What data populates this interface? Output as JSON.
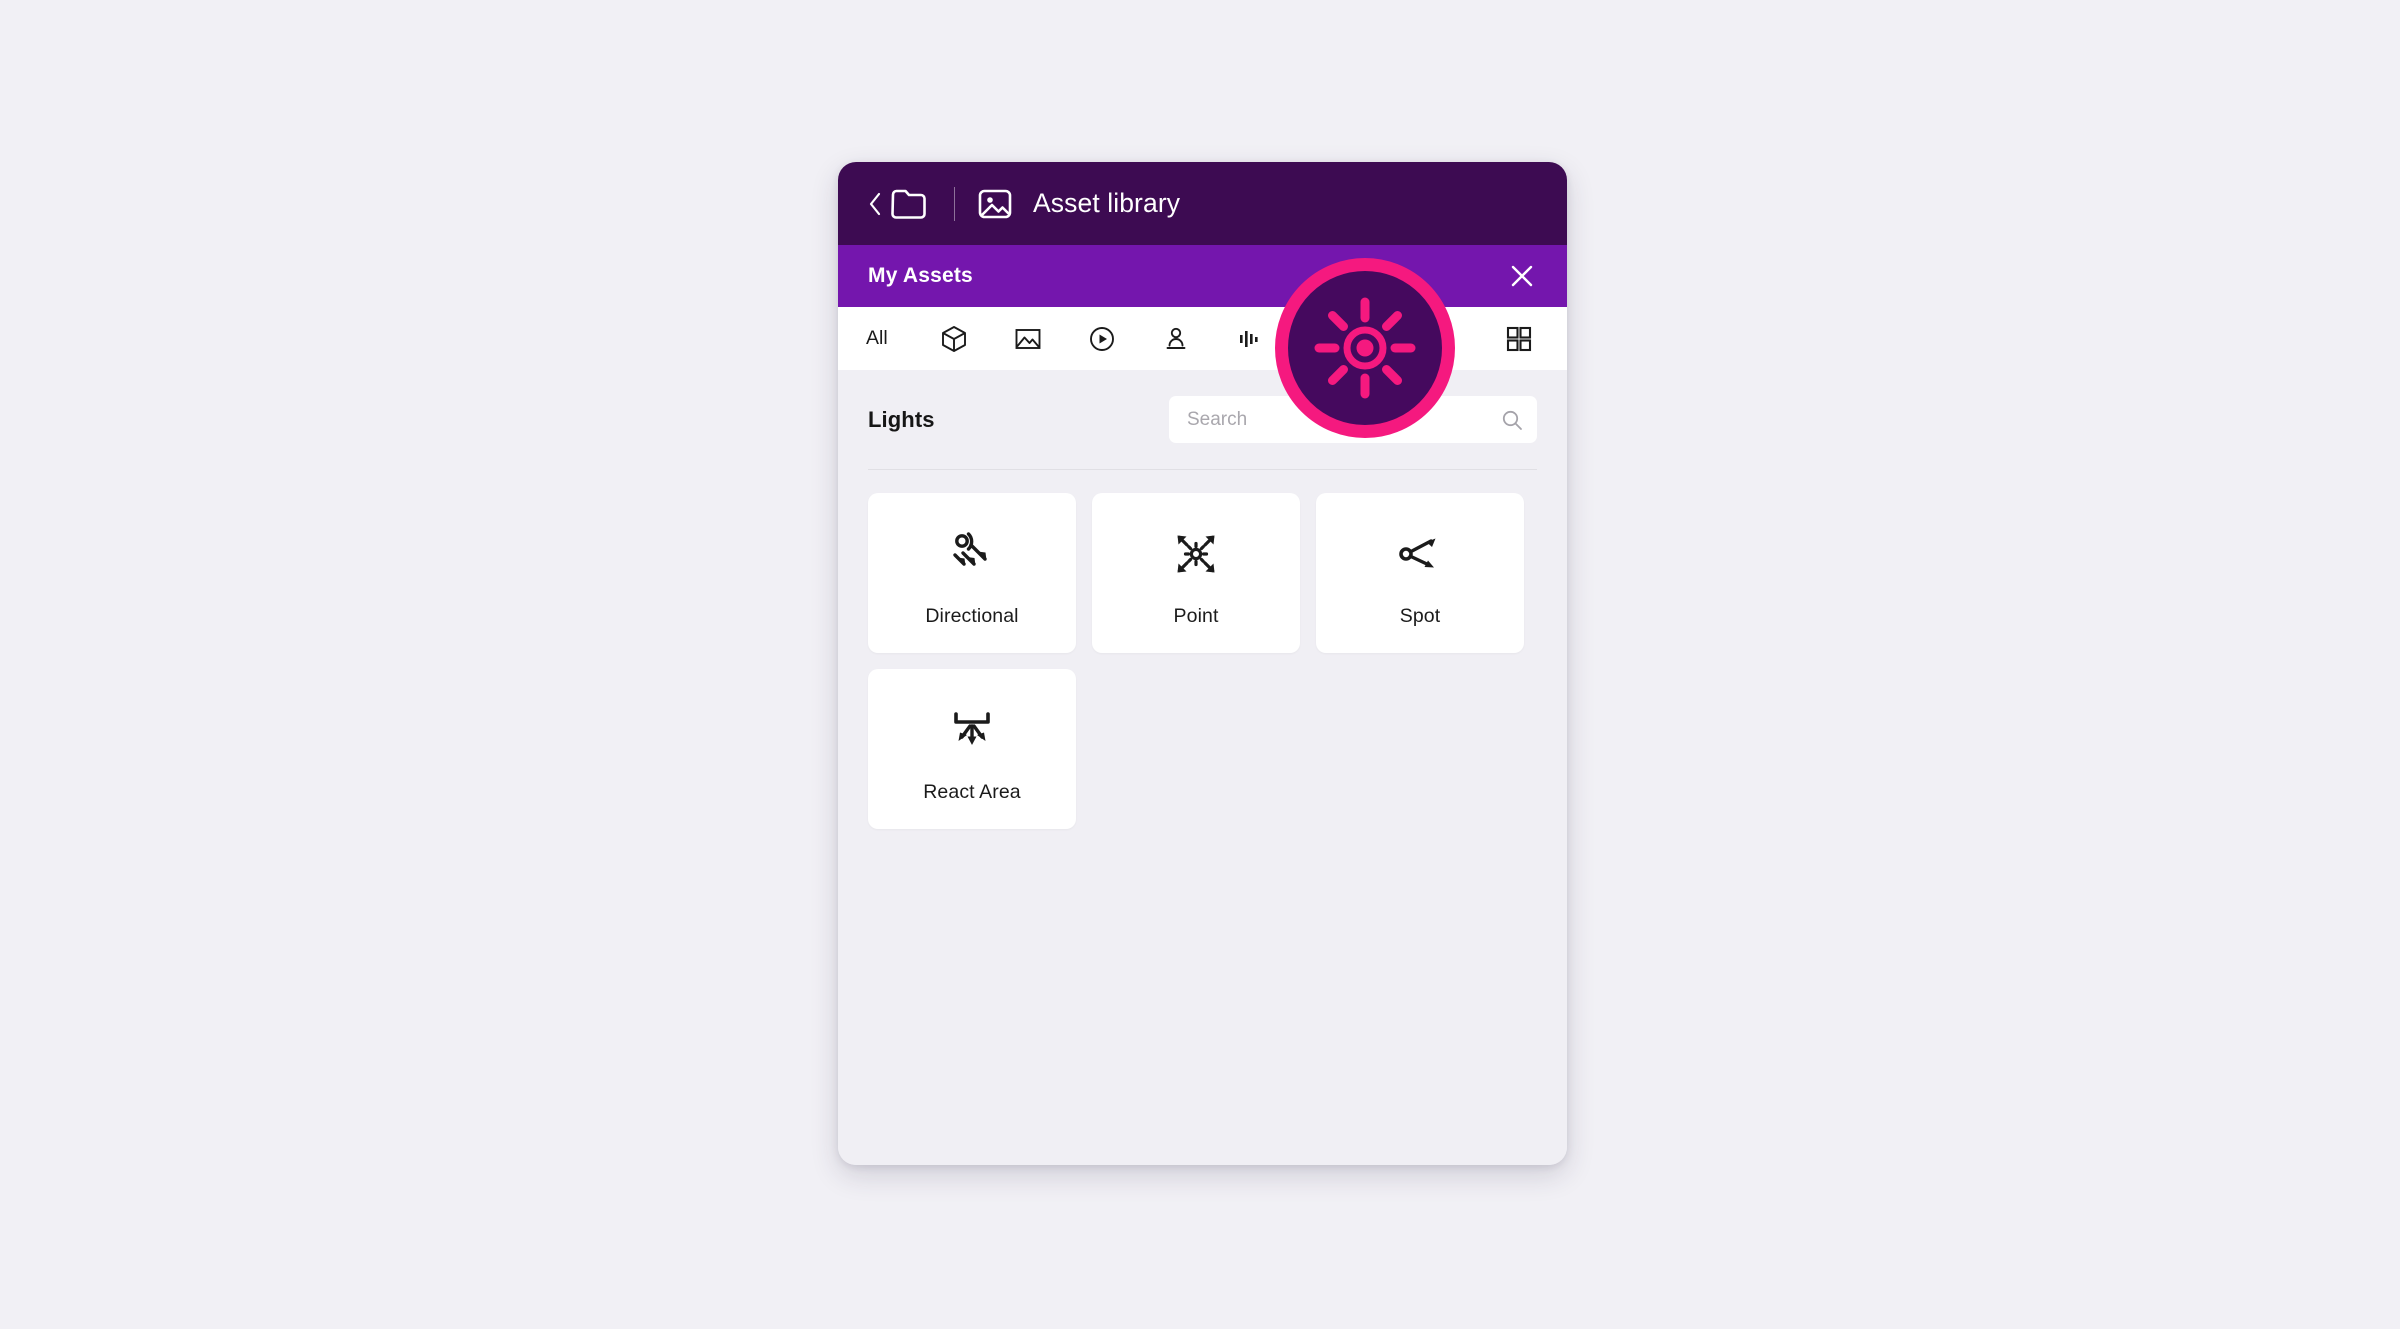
{
  "app": {
    "background_color": "#f1f0f5",
    "panel_background": "#f0eff4"
  },
  "topbar": {
    "background_color": "#3d0b52",
    "back_label": "Back",
    "folder_icon": "folder-icon",
    "library_icon": "image-icon",
    "title": "Asset library"
  },
  "assetbar": {
    "background_color": "#7416ad",
    "title": "My Assets",
    "close_icon": "close-icon"
  },
  "tabs": {
    "items": [
      {
        "id": "all",
        "label": "All",
        "icon": "text-all",
        "selected": true
      },
      {
        "id": "models",
        "label": "3D Models",
        "icon": "cube-icon",
        "selected": false
      },
      {
        "id": "images",
        "label": "Images",
        "icon": "image-icon",
        "selected": false
      },
      {
        "id": "video",
        "label": "Video",
        "icon": "play-circle-icon",
        "selected": false
      },
      {
        "id": "avatars",
        "label": "Avatars",
        "icon": "person-icon",
        "selected": false
      },
      {
        "id": "audio",
        "label": "Audio",
        "icon": "audio-waveform-icon",
        "selected": false
      },
      {
        "id": "lights",
        "label": "Lights",
        "icon": "light-sun-icon",
        "selected": false
      }
    ],
    "view_toggle": {
      "label": "Grid view",
      "icon": "grid-view-icon"
    }
  },
  "section": {
    "title": "Lights"
  },
  "search": {
    "placeholder": "Search",
    "value": "",
    "icon": "search-icon"
  },
  "assets": {
    "items": [
      {
        "label": "Directional",
        "icon": "directional-light-icon"
      },
      {
        "label": "Point",
        "icon": "point-light-icon"
      },
      {
        "label": "Spot",
        "icon": "spot-light-icon"
      },
      {
        "label": "React Area",
        "icon": "area-light-icon"
      }
    ]
  },
  "cursor_highlight": {
    "target": "lights-tab",
    "ring_color": "#f5197f",
    "fill_color": "#45095e",
    "icon": "light-sun-icon"
  }
}
